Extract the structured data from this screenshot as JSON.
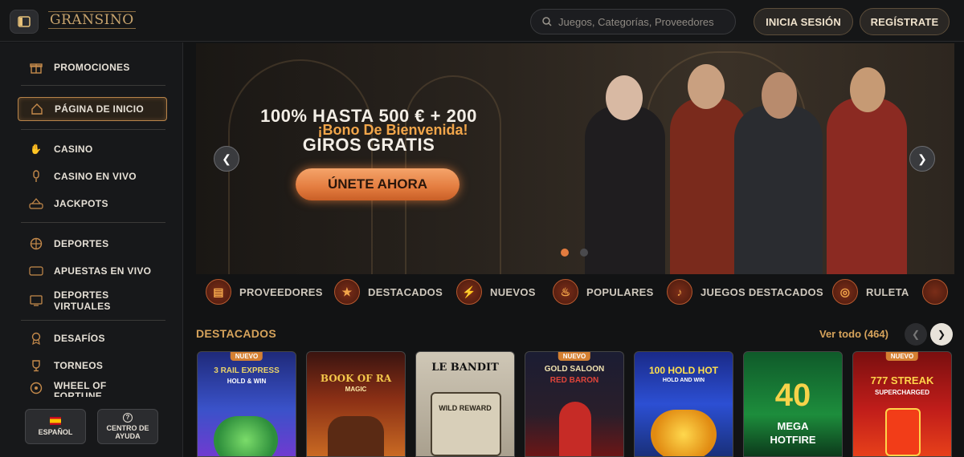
{
  "header": {
    "logo": "GRANSINO",
    "search_placeholder": "Juegos, Categorías, Proveedores",
    "login_label": "INICIA SESIÓN",
    "register_label": "REGÍSTRATE"
  },
  "sidebar": {
    "items": [
      {
        "label": "PROMOCIONES",
        "icon": "gift-icon"
      },
      {
        "label": "PÁGINA DE INICIO",
        "icon": "home-icon",
        "active": true
      },
      {
        "label": "CASINO",
        "icon": "casino-hand-icon"
      },
      {
        "label": "CASINO EN VIVO",
        "icon": "microphone-icon"
      },
      {
        "label": "JACKPOTS",
        "icon": "jackpot-win-icon"
      },
      {
        "label": "DEPORTES",
        "icon": "basketball-icon"
      },
      {
        "label": "APUESTAS EN VIVO",
        "icon": "live-icon"
      },
      {
        "label": "DEPORTES VIRTUALES",
        "icon": "virtual-sports-icon"
      },
      {
        "label": "DESAFÍOS",
        "icon": "medal-icon"
      },
      {
        "label": "TORNEOS",
        "icon": "trophy-icon"
      },
      {
        "label": "WHEEL OF FORTUNE",
        "icon": "wheel-icon"
      }
    ],
    "language_label": "ESPAÑOL",
    "help_label": "CENTRO DE AYUDA"
  },
  "hero": {
    "subtitle": "¡Bono De Bienvenida!",
    "title_line1": "100% HASTA 500 € + 200",
    "title_line2": "GIROS GRATIS",
    "cta_label": "ÚNETE AHORA",
    "active_slide": 1,
    "slide_count": 2
  },
  "categories": [
    {
      "label": "PROVEEDORES",
      "icon": "providers-icon"
    },
    {
      "label": "DESTACADOS",
      "icon": "star-icon"
    },
    {
      "label": "NUEVOS",
      "icon": "lightning-icon"
    },
    {
      "label": "POPULARES",
      "icon": "fire-icon"
    },
    {
      "label": "JUEGOS DESTACADOS",
      "icon": "microphone-icon"
    },
    {
      "label": "RULETA",
      "icon": "roulette-icon"
    }
  ],
  "featured": {
    "title": "DESTACADOS",
    "view_all": "Ver todo (464)",
    "games": [
      {
        "title": "3 RAIL EXPRESS",
        "sub": "HOLD & WIN",
        "badge": "NUEVO"
      },
      {
        "title": "BOOK OF RA",
        "sub": "MAGIC",
        "badge": ""
      },
      {
        "title": "LE BANDIT",
        "sub": "WILD REWARD",
        "badge": ""
      },
      {
        "title": "GOLD SALOON",
        "sub": "RED BARON",
        "badge": "NUEVO"
      },
      {
        "title": "100 HOLD HOT",
        "sub": "HOLD AND WIN",
        "badge": ""
      },
      {
        "title": "40",
        "sub": "MEGA HOTFIRE",
        "badge": ""
      },
      {
        "title": "777 STREAK",
        "sub": "SUPERCHARGED",
        "badge": "NUEVO"
      }
    ]
  },
  "colors": {
    "accent": "#d6a35b",
    "cta": "#e37c3f",
    "background": "#121314"
  }
}
